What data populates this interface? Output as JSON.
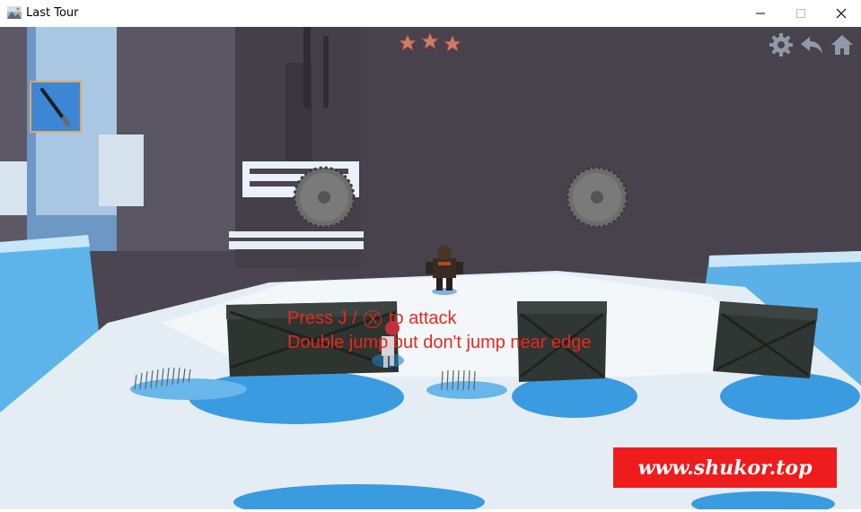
{
  "window": {
    "title": "Last Tour",
    "icons": {
      "app": "landscape-icon",
      "minimize": "minimize-icon",
      "maximize": "maximize-icon",
      "close": "close-icon"
    }
  },
  "hud": {
    "weapon_slot_icon": "bat-icon",
    "stars": {
      "rating": 3,
      "max": 3,
      "icon": "star-icon"
    },
    "buttons": {
      "settings": "gear-icon",
      "back": "undo-arrow-icon",
      "home": "home-icon"
    }
  },
  "hints": {
    "line1_before": "Press J /",
    "line1_key": "X",
    "line1_after": "to attack",
    "line2": "Double jump but don't jump near edge"
  },
  "watermark": {
    "text": "www.shukor.top"
  },
  "colors": {
    "hint": "#e8281e",
    "watermark_bg": "#ee1c1c",
    "snow": "#e9f1f7",
    "ice": "#3a9be0"
  }
}
